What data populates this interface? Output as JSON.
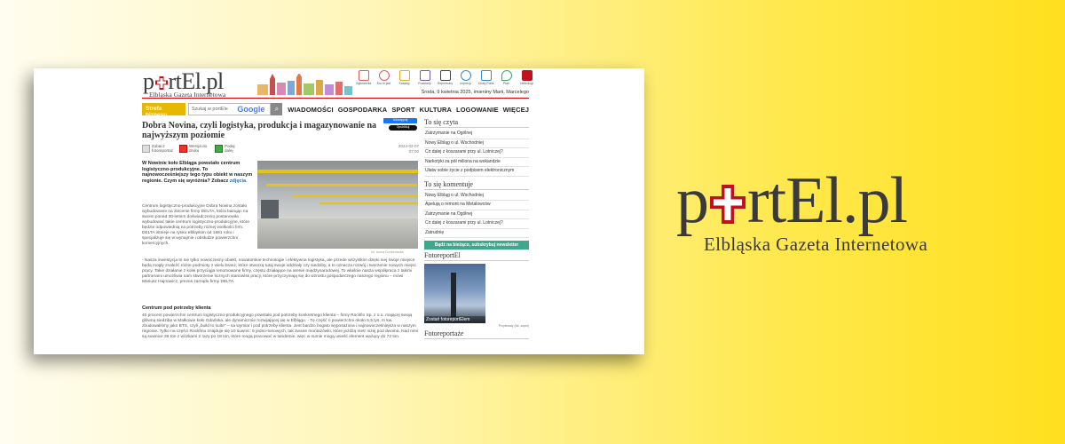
{
  "brand": {
    "logo_prefix": "p",
    "logo_suffix": "rtEl.pl",
    "subtitle": "Elbląska Gazeta Internetowa",
    "colors": {
      "accent": "#c0121e",
      "background": "#ffe84a",
      "strefa": "#e6b800",
      "subscribe": "#3ea88d"
    }
  },
  "header": {
    "icons": [
      {
        "label": "Ogłoszenia",
        "icon": "newspaper-icon",
        "color": "#e05a5a"
      },
      {
        "label": "Kto to jest",
        "icon": "person-icon",
        "color": "#e05a5a"
      },
      {
        "label": "Katalog",
        "icon": "folder-icon",
        "color": "#e0b020"
      },
      {
        "label": "Rozkłady",
        "icon": "bus-icon",
        "color": "#7a5aa8"
      },
      {
        "label": "Repertuary",
        "icon": "film-icon",
        "color": "#444444"
      },
      {
        "label": "Imprezy",
        "icon": "music-icon",
        "color": "#3a8ad0"
      },
      {
        "label": "Kluby Pubs",
        "icon": "glass-icon",
        "color": "#3a8ad0"
      },
      {
        "label": "Plan",
        "icon": "pin-icon",
        "color": "#3aa86d"
      },
      {
        "label": "Nekrologi",
        "icon": "cross-icon",
        "color": "#c0121e"
      }
    ],
    "date": "Środa, 9 kwietnia 2025, imieniny Marii, Marcelego"
  },
  "nav": {
    "strefa": "Strefa biznesu",
    "search_placeholder": "Szukaj w portEle",
    "search_engine": "Google",
    "menu": [
      "WIADOMOŚCI",
      "GOSPODARKA",
      "SPORT",
      "KULTURA",
      "LOGOWANIE",
      "WIĘCEJ"
    ]
  },
  "social": {
    "fb": "Udostępnij",
    "x": "Opublikuj"
  },
  "article": {
    "title": "Dobra Novina, czyli logistyka, produkcja i magazynowanie na najwyższym poziomie",
    "tools": [
      "Zobacz fotoreportaż",
      "Wersja do druku",
      "Podaj dalej"
    ],
    "date": "2024-02-07",
    "time": "07:00",
    "lead": "W Nowinie koło Elbląga powstało centrum logistyczno-produkcyjne. To najnowocześniejszy tego typu obiekt w naszym regionie. Czym się wyróżnia? Zobacz",
    "lead_link": "zdjęcia.",
    "photo_credit": "fot. Iwona Dombrowska",
    "body1": "Centrum logistyczno-produkcyjne Dobra Novina zostało wybudowane na zlecenie firmy DELTA, która bazując na swoim ponad 30-letnim doświadczeniu postanowiła wybudować takie centrum logistyczno-produkcyjne, które będzie odpowiednią na potrzeby różnej wielkości firm. DELTA istnieje na rynku elbląskim od 1991 roku i specjalizuje się w wynajmie i obsłudze powierzchni komercyjnych.",
    "body2": "- Nasza inwestycja to nie tylko nowoczesny obiekt, nowatorskie technologie i efektywna logistyka, ale przede wszystkim dzięki niej swoje miejsce będą mogły znaleźć różne podmioty z wielu branż, które otworzą tutaj swoje oddziały czy siedziby, a to oznacza rozwój i tworzenie nowych miejsc pracy. Takie działanie z kolei przyciąga renomowane firmy, często działające na arenie międzynarodowej. To właśnie nasza współpraca z takimi partnerami umożliwia nam stworzenie licznych stanowisk pracy, które przyczyniają się do wzrostu gospodarczego naszego regionu – mówi Mariusz Hajnowicz, prezes zarządu firmy DELTA.",
    "subheading": "Centrum pod potrzeby klienta",
    "body3": "40 procent powierzchni centrum logistyczno-produkcyjnego powstało pod potrzeby konkretnego klienta – firmy Rockfin Sp. z o.o. mającej swoją główną siedzibę w Małkowie koło Gdańska, ale dynamicznie rozwijającej się w Elblągu. - Tę część o powierzchni około 5,5 tys. m kw. zbudowaliśmy jako BTS, czyli „build to suite” – na wymiar i pod potrzeby klienta. Jest bardzo bogato wyposażona i najnowocześniejsza w naszym regionie. Tylko na części Rockfinu znajduje się 10 suwnic: 6 jedno-tonowych, tak zwane montażówki, które jeżdżą metr niżej pod dwoma. Nad nimi są suwnice 36 ton z wózkami 2 razy po 18 ton, które mogą pracować w tandemie, więc w sumie mogą unieść element ważący do 72 ton."
  },
  "sidebar": {
    "hot_title": "To się czyta",
    "hot": [
      "Zatrzymanie na Ogólnej",
      "Nowy Elbląg o ul. Wschodniej",
      "Co dalej z koszarami przy ul. Lotniczej?",
      "Narkotyki za pół miliona na wokandzie",
      "Ułatw sobie życie z podpisem elektronicznym"
    ],
    "comments_title": "To się komentuje",
    "comments": [
      "Nowy Elbląg o ul. Wschodniej",
      "Apelują o remont na Metalowców",
      "Zatrzymanie na Ogólnej",
      "Co dalej z koszarami przy ul. Lotniczej?",
      "Zatrudnię"
    ],
    "subscribe": "Bądź na bieżąco, subskrybuj newsletter",
    "foto_title": "FotoreportEl",
    "foto_caption": "Zostań fotoreportElem",
    "foto_credit": "Przyleciały (fot. sopel)",
    "next_title": "Fotoreportaże"
  }
}
